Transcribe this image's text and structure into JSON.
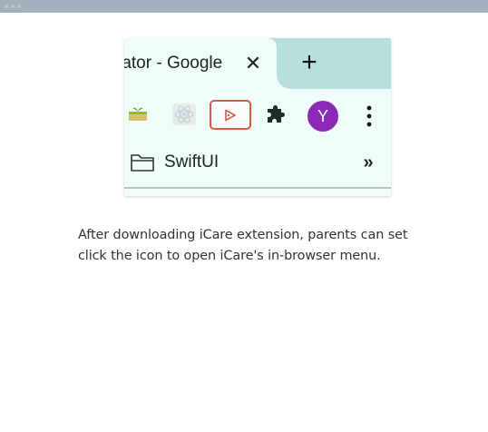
{
  "window": {
    "dots": [
      "dot",
      "dot",
      "dot"
    ]
  },
  "browser": {
    "tab": {
      "title_visible": "rator - Google",
      "close_glyph": "✕"
    },
    "new_tab_glyph": "+",
    "toolbar": {
      "extensions": [
        {
          "icon": "plant-pot-extension-icon"
        },
        {
          "icon": "react-atom-extension-icon"
        },
        {
          "icon": "icare-play-extension-icon",
          "highlighted": true,
          "highlight_color": "#d65a4a"
        },
        {
          "icon": "puzzle-extensions-icon"
        }
      ],
      "avatar_initial": "Y",
      "avatar_color": "#8a2ab6",
      "menu_icon": "more-vertical-icon"
    },
    "bookmarks": {
      "folder_label": "SwiftUI",
      "overflow_glyph": "»"
    },
    "colors": {
      "tabstrip": "#b5e0dc",
      "page": "#eefcfa"
    }
  },
  "caption": {
    "line1": "After downloading iCare extension, parents can set",
    "line2": "click the icon to open iCare's in-browser menu."
  }
}
